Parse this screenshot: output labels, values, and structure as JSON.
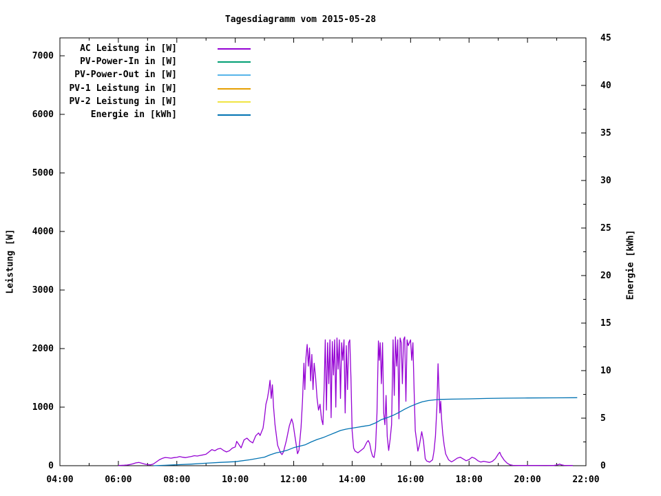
{
  "chart": {
    "title": "Tagesdiagramm vom 2015-05-28",
    "ylabel_left": "Leistung [W]",
    "ylabel_right": "Energie [kWh]"
  },
  "colors": {
    "ac": "#9400D3",
    "pv_power_in": "#009E73",
    "pv_power_out": "#56B4E9",
    "pv1": "#E69F00",
    "pv2": "#F0E442",
    "energie": "#0072B2",
    "axis": "#000000",
    "background": "#FFFFFF"
  },
  "chart_data": {
    "type": "line",
    "title": "Tagesdiagramm vom 2015-05-28",
    "xlabel": "",
    "ylabel_left": "Leistung [W]",
    "ylabel_right": "Energie [kWh]",
    "x_unit": "hour of day",
    "x_range_hours": [
      4,
      22
    ],
    "x_ticks": [
      "04:00",
      "06:00",
      "08:00",
      "10:00",
      "12:00",
      "14:00",
      "16:00",
      "18:00",
      "20:00",
      "22:00"
    ],
    "x_minor_tick_every_hours": 1,
    "ylim_left": [
      0,
      7300
    ],
    "left_ticks": [
      0,
      1000,
      2000,
      3000,
      4000,
      5000,
      6000,
      7000
    ],
    "ylim_right": [
      0,
      45
    ],
    "right_ticks": [
      0,
      5,
      10,
      15,
      20,
      25,
      30,
      35,
      40,
      45
    ],
    "right_minor_tick_step": 2.5,
    "grid": false,
    "legend_position": "upper-left",
    "legend": [
      {
        "label": "AC Leistung in [W]",
        "color": "#9400D3"
      },
      {
        "label": "PV-Power-In in [W]",
        "color": "#009E73"
      },
      {
        "label": "PV-Power-Out in [W]",
        "color": "#56B4E9"
      },
      {
        "label": "PV-1 Leistung in [W]",
        "color": "#E69F00"
      },
      {
        "label": "PV-2 Leistung in [W]",
        "color": "#F0E442"
      },
      {
        "label": "Energie in [kWh]",
        "color": "#0072B2"
      }
    ],
    "series": [
      {
        "name": "AC Leistung in [W]",
        "color": "#9400D3",
        "axis": "left",
        "unit": "W",
        "points": [
          [
            6.0,
            3
          ],
          [
            6.1,
            6
          ],
          [
            6.2,
            8
          ],
          [
            6.3,
            12
          ],
          [
            6.4,
            20
          ],
          [
            6.5,
            32
          ],
          [
            6.6,
            48
          ],
          [
            6.7,
            55
          ],
          [
            6.8,
            42
          ],
          [
            6.9,
            28
          ],
          [
            7.0,
            18
          ],
          [
            7.1,
            15
          ],
          [
            7.2,
            30
          ],
          [
            7.3,
            65
          ],
          [
            7.4,
            100
          ],
          [
            7.5,
            125
          ],
          [
            7.6,
            140
          ],
          [
            7.7,
            135
          ],
          [
            7.8,
            128
          ],
          [
            7.9,
            138
          ],
          [
            8.0,
            142
          ],
          [
            8.1,
            155
          ],
          [
            8.2,
            145
          ],
          [
            8.3,
            138
          ],
          [
            8.4,
            148
          ],
          [
            8.5,
            158
          ],
          [
            8.6,
            170
          ],
          [
            8.7,
            165
          ],
          [
            8.8,
            175
          ],
          [
            8.9,
            185
          ],
          [
            9.0,
            195
          ],
          [
            9.1,
            235
          ],
          [
            9.2,
            275
          ],
          [
            9.3,
            255
          ],
          [
            9.4,
            285
          ],
          [
            9.5,
            295
          ],
          [
            9.6,
            260
          ],
          [
            9.7,
            235
          ],
          [
            9.8,
            255
          ],
          [
            9.9,
            300
          ],
          [
            10.0,
            320
          ],
          [
            10.05,
            415
          ],
          [
            10.1,
            380
          ],
          [
            10.2,
            305
          ],
          [
            10.3,
            440
          ],
          [
            10.4,
            470
          ],
          [
            10.5,
            420
          ],
          [
            10.6,
            390
          ],
          [
            10.7,
            510
          ],
          [
            10.8,
            560
          ],
          [
            10.85,
            515
          ],
          [
            10.9,
            580
          ],
          [
            10.95,
            640
          ],
          [
            11.0,
            820
          ],
          [
            11.05,
            1050
          ],
          [
            11.1,
            1150
          ],
          [
            11.15,
            1300
          ],
          [
            11.19,
            1459
          ],
          [
            11.23,
            1150
          ],
          [
            11.27,
            1380
          ],
          [
            11.31,
            1000
          ],
          [
            11.36,
            700
          ],
          [
            11.45,
            350
          ],
          [
            11.55,
            220
          ],
          [
            11.6,
            190
          ],
          [
            11.65,
            235
          ],
          [
            11.75,
            430
          ],
          [
            11.85,
            680
          ],
          [
            11.93,
            800
          ],
          [
            11.98,
            715
          ],
          [
            12.03,
            545
          ],
          [
            12.08,
            375
          ],
          [
            12.13,
            205
          ],
          [
            12.18,
            265
          ],
          [
            12.25,
            650
          ],
          [
            12.3,
            1100
          ],
          [
            12.35,
            1750
          ],
          [
            12.38,
            1300
          ],
          [
            12.42,
            1850
          ],
          [
            12.46,
            2070
          ],
          [
            12.5,
            1700
          ],
          [
            12.54,
            2010
          ],
          [
            12.58,
            1450
          ],
          [
            12.62,
            1900
          ],
          [
            12.66,
            1300
          ],
          [
            12.7,
            1750
          ],
          [
            12.75,
            1500
          ],
          [
            12.8,
            1150
          ],
          [
            12.85,
            950
          ],
          [
            12.9,
            1050
          ],
          [
            12.95,
            800
          ],
          [
            13.0,
            700
          ],
          [
            13.04,
            1300
          ],
          [
            13.08,
            2150
          ],
          [
            13.12,
            950
          ],
          [
            13.16,
            2100
          ],
          [
            13.2,
            1400
          ],
          [
            13.24,
            2150
          ],
          [
            13.28,
            820
          ],
          [
            13.32,
            2120
          ],
          [
            13.36,
            1550
          ],
          [
            13.4,
            2150
          ],
          [
            13.44,
            1000
          ],
          [
            13.48,
            2180
          ],
          [
            13.52,
            1650
          ],
          [
            13.56,
            2150
          ],
          [
            13.6,
            1150
          ],
          [
            13.64,
            2100
          ],
          [
            13.68,
            1800
          ],
          [
            13.72,
            2150
          ],
          [
            13.76,
            900
          ],
          [
            13.8,
            2050
          ],
          [
            13.84,
            1300
          ],
          [
            13.88,
            2100
          ],
          [
            13.92,
            2150
          ],
          [
            13.96,
            1500
          ],
          [
            14.0,
            600
          ],
          [
            14.05,
            300
          ],
          [
            14.1,
            250
          ],
          [
            14.2,
            220
          ],
          [
            14.3,
            260
          ],
          [
            14.4,
            300
          ],
          [
            14.5,
            400
          ],
          [
            14.55,
            430
          ],
          [
            14.6,
            380
          ],
          [
            14.65,
            250
          ],
          [
            14.7,
            160
          ],
          [
            14.75,
            140
          ],
          [
            14.8,
            300
          ],
          [
            14.85,
            900
          ],
          [
            14.9,
            2130
          ],
          [
            14.93,
            1800
          ],
          [
            14.96,
            2100
          ],
          [
            15.0,
            1400
          ],
          [
            15.04,
            2100
          ],
          [
            15.08,
            900
          ],
          [
            15.12,
            700
          ],
          [
            15.16,
            1200
          ],
          [
            15.2,
            500
          ],
          [
            15.25,
            260
          ],
          [
            15.3,
            450
          ],
          [
            15.35,
            700
          ],
          [
            15.4,
            2150
          ],
          [
            15.44,
            1200
          ],
          [
            15.48,
            2200
          ],
          [
            15.52,
            1700
          ],
          [
            15.56,
            2150
          ],
          [
            15.6,
            800
          ],
          [
            15.64,
            2180
          ],
          [
            15.68,
            2100
          ],
          [
            15.72,
            1400
          ],
          [
            15.76,
            2150
          ],
          [
            15.8,
            2200
          ],
          [
            15.84,
            1100
          ],
          [
            15.88,
            2150
          ],
          [
            15.92,
            2050
          ],
          [
            15.96,
            2100
          ],
          [
            16.0,
            2150
          ],
          [
            16.04,
            1800
          ],
          [
            16.08,
            2100
          ],
          [
            16.12,
            1300
          ],
          [
            16.16,
            600
          ],
          [
            16.2,
            450
          ],
          [
            16.25,
            250
          ],
          [
            16.3,
            350
          ],
          [
            16.38,
            580
          ],
          [
            16.44,
            420
          ],
          [
            16.5,
            120
          ],
          [
            16.55,
            80
          ],
          [
            16.6,
            70
          ],
          [
            16.65,
            60
          ],
          [
            16.7,
            80
          ],
          [
            16.75,
            100
          ],
          [
            16.8,
            250
          ],
          [
            16.85,
            500
          ],
          [
            16.9,
            1000
          ],
          [
            16.94,
            1741
          ],
          [
            16.97,
            1300
          ],
          [
            17.0,
            900
          ],
          [
            17.03,
            1100
          ],
          [
            17.06,
            800
          ],
          [
            17.1,
            550
          ],
          [
            17.15,
            350
          ],
          [
            17.2,
            200
          ],
          [
            17.3,
            100
          ],
          [
            17.4,
            65
          ],
          [
            17.5,
            95
          ],
          [
            17.6,
            130
          ],
          [
            17.7,
            145
          ],
          [
            17.8,
            115
          ],
          [
            17.9,
            85
          ],
          [
            18.0,
            105
          ],
          [
            18.1,
            145
          ],
          [
            18.2,
            125
          ],
          [
            18.3,
            85
          ],
          [
            18.4,
            62
          ],
          [
            18.5,
            75
          ],
          [
            18.6,
            65
          ],
          [
            18.7,
            55
          ],
          [
            18.8,
            75
          ],
          [
            18.9,
            120
          ],
          [
            19.0,
            200
          ],
          [
            19.05,
            230
          ],
          [
            19.1,
            170
          ],
          [
            19.2,
            95
          ],
          [
            19.3,
            45
          ],
          [
            19.4,
            15
          ],
          [
            19.5,
            6
          ],
          [
            19.7,
            4
          ],
          [
            20.0,
            4
          ],
          [
            20.3,
            4
          ],
          [
            20.6,
            5
          ],
          [
            20.9,
            4
          ],
          [
            21.05,
            18
          ],
          [
            21.1,
            28
          ],
          [
            21.15,
            15
          ],
          [
            21.25,
            6
          ],
          [
            21.4,
            4
          ],
          [
            21.55,
            3
          ]
        ]
      },
      {
        "name": "Energie in [kWh]",
        "color": "#0072B2",
        "axis": "right",
        "unit": "kWh",
        "points": [
          [
            7.2,
            0.0
          ],
          [
            7.6,
            0.04
          ],
          [
            8.0,
            0.1
          ],
          [
            8.5,
            0.17
          ],
          [
            9.0,
            0.26
          ],
          [
            9.5,
            0.35
          ],
          [
            10.0,
            0.42
          ],
          [
            10.5,
            0.62
          ],
          [
            11.0,
            0.9
          ],
          [
            11.2,
            1.15
          ],
          [
            11.4,
            1.35
          ],
          [
            11.6,
            1.48
          ],
          [
            11.8,
            1.65
          ],
          [
            12.0,
            1.9
          ],
          [
            12.2,
            2.05
          ],
          [
            12.4,
            2.2
          ],
          [
            12.6,
            2.5
          ],
          [
            12.8,
            2.75
          ],
          [
            13.0,
            2.95
          ],
          [
            13.2,
            3.2
          ],
          [
            13.4,
            3.45
          ],
          [
            13.6,
            3.7
          ],
          [
            13.8,
            3.85
          ],
          [
            14.0,
            3.95
          ],
          [
            14.2,
            4.05
          ],
          [
            14.4,
            4.15
          ],
          [
            14.6,
            4.25
          ],
          [
            14.8,
            4.5
          ],
          [
            15.0,
            4.85
          ],
          [
            15.2,
            5.05
          ],
          [
            15.4,
            5.3
          ],
          [
            15.6,
            5.6
          ],
          [
            15.8,
            5.95
          ],
          [
            16.0,
            6.25
          ],
          [
            16.2,
            6.5
          ],
          [
            16.4,
            6.72
          ],
          [
            16.6,
            6.85
          ],
          [
            16.8,
            6.92
          ],
          [
            17.0,
            6.97
          ],
          [
            17.4,
            7.0
          ],
          [
            18.0,
            7.03
          ],
          [
            18.6,
            7.07
          ],
          [
            19.2,
            7.1
          ],
          [
            20.0,
            7.12
          ],
          [
            21.0,
            7.14
          ],
          [
            21.7,
            7.15
          ]
        ]
      }
    ]
  }
}
